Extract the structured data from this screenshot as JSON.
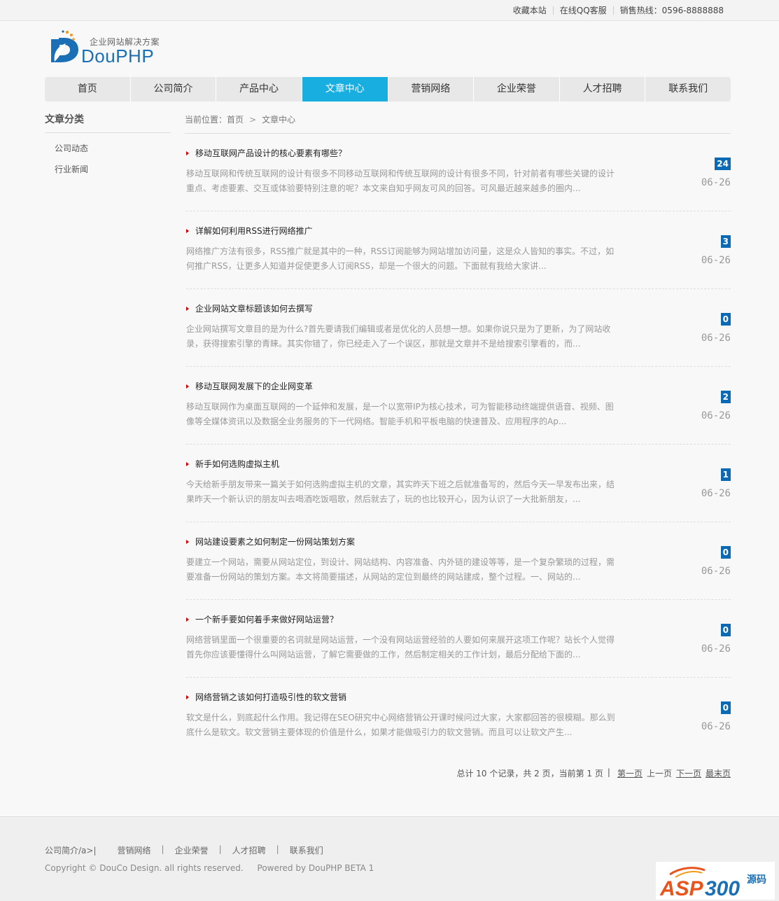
{
  "topbar": {
    "links": [
      "收藏本站",
      "在线QQ客服",
      "销售热线：0596-8888888"
    ]
  },
  "logo": {
    "tagline": "企业网站解决方案",
    "brand": "DouPHP"
  },
  "nav": {
    "items": [
      "首页",
      "公司简介",
      "产品中心",
      "文章中心",
      "营销网络",
      "企业荣誉",
      "人才招聘",
      "联系我们"
    ],
    "active": "文章中心"
  },
  "sidebar": {
    "title": "文章分类",
    "items": [
      "公司动态",
      "行业新闻"
    ]
  },
  "breadcrumb": {
    "prefix": "当前位置：",
    "home": "首页",
    "separator": ">",
    "current": "文章中心"
  },
  "articles": [
    {
      "title": "移动互联网产品设计的核心要素有哪些？",
      "summary": "移动互联网和传统互联网的设计有很多不同移动互联网和传统互联网的设计有很多不同，针对前者有哪些关键的设计重点、考虑要素、交互或体验要特别注意的呢？本文来自知乎网友可风的回答。可风最近越来越多的圈内...",
      "count": "24",
      "date": "06-26"
    },
    {
      "title": "详解如何利用RSS进行网络推广",
      "summary": "网络推广方法有很多，RSS推广就是其中的一种，RSS订阅能够为网站增加访问量，这是众人皆知的事实。不过，如何推广RSS，让更多人知道并促使更多人订阅RSS，却是一个很大的问题。下面就有我给大家讲...",
      "count": "3",
      "date": "06-26"
    },
    {
      "title": "企业网站文章标题该如何去撰写",
      "summary": "企业网站撰写文章目的是为什么?首先要请我们编辑或者是优化的人员想一想。如果你说只是为了更新，为了网站收录，获得搜索引擎的青睐。其实你错了，你已经走入了一个误区，那就是文章并不是给搜索引擎看的，而...",
      "count": "0",
      "date": "06-26"
    },
    {
      "title": "移动互联网发展下的企业网变革",
      "summary": "移动互联网作为桌面互联网的一个延伸和发展，是一个以宽带IP为核心技术，可为智能移动终端提供语音、视频、图像等全媒体资讯以及数据全业务服务的下一代网络。智能手机和平板电脑的快速普及、应用程序的Ap...",
      "count": "2",
      "date": "06-26"
    },
    {
      "title": "新手如何选购虚拟主机",
      "summary": "今天给新手朋友带来一篇关于如何选购虚拟主机的文章，其实昨天下班之后就准备写的，然后今天一早发布出来，结果昨天一个新认识的朋友叫去喝酒吃饭唱歌，然后就去了，玩的也比较开心，因为认识了一大批新朋友，...",
      "count": "1",
      "date": "06-26"
    },
    {
      "title": "网站建设要素之如何制定一份网站策划方案",
      "summary": "要建立一个网站，需要从网站定位，到设计、网站结构、内容准备、内外链的建设等等，是一个复杂繁琐的过程，需要准备一份网站的策划方案。本文将简要描述，从网站的定位到最终的网站建成，整个过程。一、网站的...",
      "count": "0",
      "date": "06-26"
    },
    {
      "title": "一个新手要如何着手来做好网站运营？",
      "summary": "网络营销里面一个很重要的名词就是网站运营，一个没有网站运营经验的人要如何来展开这项工作呢？站长个人觉得首先你应该要懂得什么叫网站运营，了解它需要做的工作，然后制定相关的工作计划，最后分配给下面的...",
      "count": "0",
      "date": "06-26"
    },
    {
      "title": "网络营销之该如何打造吸引性的软文营销",
      "summary": "软文是什么，到底起什么作用。我记得在SEO研究中心网络营销公开课时候问过大家，大家都回答的很模糊。那么到底什么是软文。软文营销主要体现的价值是什么，如果才能做吸引力的软文营销。而且可以让软文产生...",
      "count": "0",
      "date": "06-26"
    }
  ],
  "pager": {
    "summary": "总计 10 个记录，共 2 页，当前第 1 页",
    "bar": "|",
    "first": "第一页",
    "prev": "上一页",
    "next": "下一页",
    "last": "最末页"
  },
  "footer": {
    "links": [
      "公司简介/a>|",
      "营销网络",
      "企业荣誉",
      "人才招聘",
      "联系我们"
    ],
    "separator": "|",
    "copyright": "Copyright © DouCo Design. all rights reserved.",
    "powered": "Powered by DouPHP BETA 1"
  },
  "watermark": {
    "text": "ASP300源码"
  },
  "colors": {
    "accent": "#19aee0",
    "badge": "#0c6ab4",
    "bullet": "#cc0000",
    "brand": "#1b6fb5"
  }
}
